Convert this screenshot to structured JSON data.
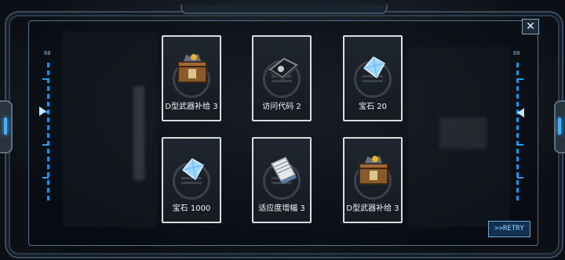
{
  "rewards": [
    {
      "name": "D型武器补给 3",
      "icon": "weapon-crate-icon"
    },
    {
      "name": "访问代码 2",
      "icon": "access-code-icon"
    },
    {
      "name": "宝石 20",
      "icon": "gem-icon"
    },
    {
      "name": "宝石 1000",
      "icon": "gem-icon"
    },
    {
      "name": "适应度增幅 3",
      "icon": "document-icon"
    },
    {
      "name": "D型武器补给 3",
      "icon": "weapon-crate-icon"
    }
  ],
  "gauge": {
    "left_label": "60",
    "right_label": "60"
  },
  "buttons": {
    "close": "✕",
    "retry": ">>RETRY"
  },
  "colors": {
    "accent": "#39b5ff",
    "card_border": "#d8dde2"
  }
}
